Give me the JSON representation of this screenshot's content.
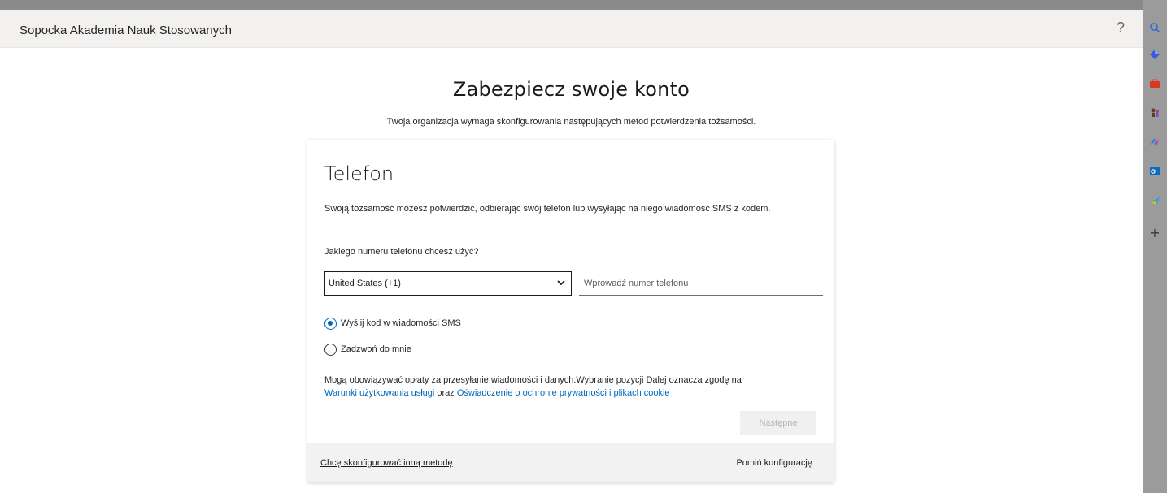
{
  "header": {
    "org_name": "Sopocka Akademia Nauk Stosowanych",
    "help_label": "?"
  },
  "page": {
    "title": "Zabezpiecz swoje konto",
    "subtitle": "Twoja organizacja wymaga skonfigurowania następujących metod potwierdzenia tożsamości."
  },
  "card": {
    "method_title": "Telefon",
    "description": "Swoją tożsamość możesz potwierdzić, odbierając swój telefon lub wysyłając na niego wiadomość SMS z kodem.",
    "question": "Jakiego numeru telefonu chcesz użyć?",
    "country_select": {
      "value": "United States (+1)"
    },
    "phone_input": {
      "value": "",
      "placeholder": "Wprowadź numer telefonu"
    },
    "options": [
      {
        "label": "Wyślij kod w wiadomości SMS",
        "checked": true
      },
      {
        "label": "Zadzwoń do mnie",
        "checked": false
      }
    ],
    "legal": {
      "text": "Mogą obowiązywać opłaty za przesyłanie wiadomości i danych.Wybranie pozycji Dalej oznacza zgodę na",
      "terms_link": "Warunki użytkowania usługi",
      "connector": "oraz",
      "privacy_link": "Oświadczenie o ochronie prywatności i plikach cookie"
    },
    "next_button": "Następne",
    "footer": {
      "other_method": "Chcę skonfigurować inną metodę",
      "skip": "Pomiń konfigurację"
    }
  },
  "side_rail": {
    "icons": [
      "search-icon",
      "diamond-icon",
      "briefcase-icon",
      "chess-icon",
      "copilot-icon",
      "outlook-icon",
      "send-icon",
      "plus-icon"
    ],
    "plus_label": "+"
  },
  "colors": {
    "accent": "#0067b8",
    "header_bg": "#f2f1f0",
    "footer_bg": "#f2f2f2",
    "rail_bg": "#9b9b9b"
  }
}
